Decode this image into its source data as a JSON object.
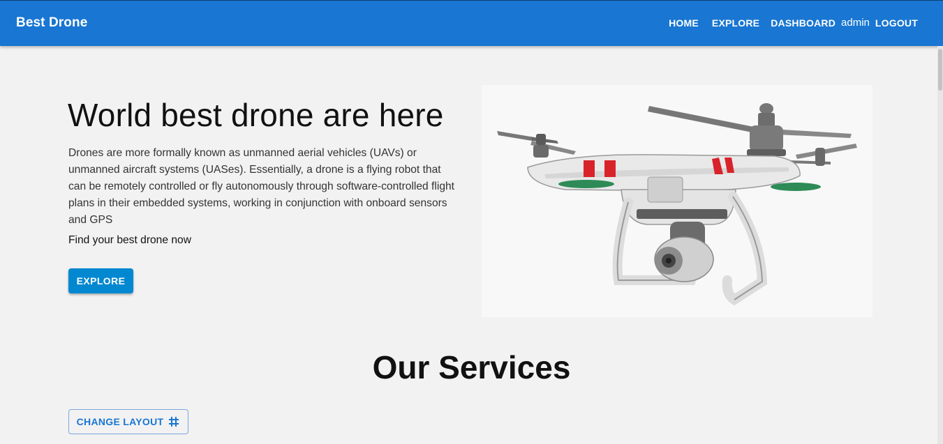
{
  "header": {
    "brand": "Best Drone",
    "nav": {
      "home": "HOME",
      "explore": "EXPLORE",
      "dashboard": "DASHBOARD",
      "user": "admin",
      "logout": "LOGOUT"
    }
  },
  "hero": {
    "title": "World best drone are here",
    "description": "Drones are more formally known as unmanned aerial vehicles (UAVs) or unmanned aircraft systems (UASes). Essentially, a drone is a flying robot that can be remotely controlled or fly autonomously through software-controlled flight plans in their embedded systems, working in conjunction with onboard sensors and GPS",
    "subtitle": "Find your best drone now",
    "cta": "EXPLORE",
    "image_icon": "drone-image"
  },
  "services": {
    "title": "Our Services",
    "change_layout": "CHANGE LAYOUT",
    "layout_icon": "grid-icon"
  },
  "colors": {
    "primary": "#1976d2",
    "button": "#0288d1",
    "background": "#f2f2f2"
  }
}
